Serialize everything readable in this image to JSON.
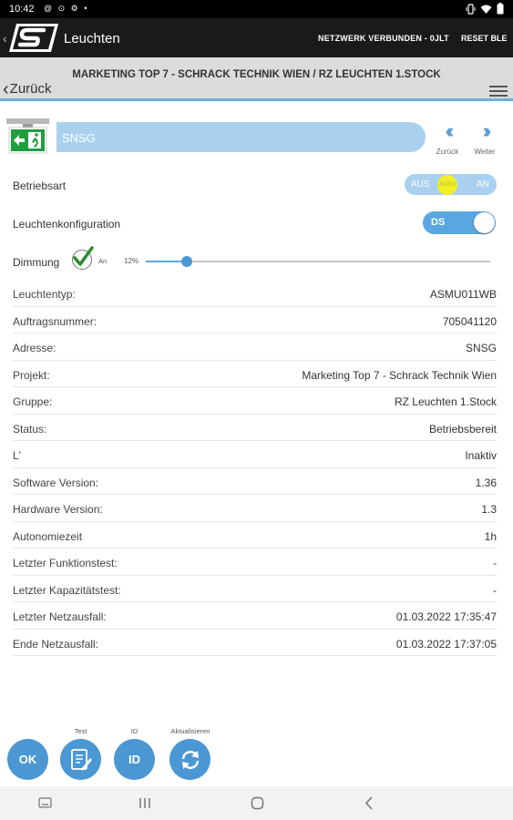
{
  "status_bar": {
    "time": "10:42",
    "left_icons": "@ ⊙ ⚙ •",
    "right_icons": [
      "vibrate-icon",
      "wifi-icon",
      "battery-icon"
    ]
  },
  "app_bar": {
    "title": "Leuchten",
    "network_status": "NETZWERK VERBUNDEN - 0JLT",
    "reset_ble": "RESET BLE"
  },
  "sub_header": {
    "path": "MARKETING TOP 7 - SCHRACK TECHNIK WIEN / RZ LEUCHTEN 1.STOCK",
    "back_label": "Zurück"
  },
  "device": {
    "name": "SNSG",
    "prev_label": "Zurück",
    "next_label": "Weiter"
  },
  "settings": {
    "betriebsart_label": "Betriebsart",
    "mode_options": [
      "AUS",
      "AUTO",
      "AN"
    ],
    "mode_selected": "AUTO",
    "config_label": "Leuchtenkonfiguration",
    "config_value": "DS",
    "config_on": true,
    "dimmung_label": "Dimmung",
    "dimmung_checked": true,
    "dimmung_check_label": "An",
    "dimmung_percent": "12%",
    "dimmung_value": 12
  },
  "info": [
    {
      "key": "Leuchtentyp:",
      "value": "ASMU011WB"
    },
    {
      "key": "Auftragsnummer:",
      "value": "705041120"
    },
    {
      "key": "Adresse:",
      "value": "SNSG"
    },
    {
      "key": "Projekt:",
      "value": "Marketing Top 7 - Schrack Technik Wien"
    },
    {
      "key": "Gruppe:",
      "value": "RZ Leuchten 1.Stock"
    },
    {
      "key": "Status:",
      "value": "Betriebsbereit"
    },
    {
      "key": "L'",
      "value": "Inaktiv"
    },
    {
      "key": "Software Version:",
      "value": "1.36"
    },
    {
      "key": "Hardware Version:",
      "value": "1.3"
    },
    {
      "key": "Autonomiezeit",
      "value": "1h"
    },
    {
      "key": "Letzter Funktionstest:",
      "value": "-"
    },
    {
      "key": "Letzter Kapazitätstest:",
      "value": "-"
    },
    {
      "key": "Letzter Netzausfall:",
      "value": "01.03.2022 17:35:47"
    },
    {
      "key": "Ende Netzausfall:",
      "value": "01.03.2022 17:37:05"
    }
  ],
  "actions": {
    "ok_label": "OK",
    "test_caption": "Test",
    "id_caption": "ID",
    "id_label": "ID",
    "refresh_caption": "Aktualisieren"
  },
  "colors": {
    "accent": "#4b97d4",
    "pill": "#a9d0ef",
    "auto_highlight": "#f2ef25",
    "app_bar": "#1a1a1a",
    "header": "#dcdcdc"
  }
}
